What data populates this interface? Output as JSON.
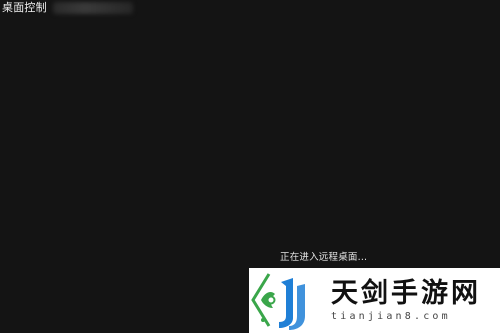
{
  "window": {
    "title": "桌面控制"
  },
  "main": {
    "status_text": "正在进入远程桌面..."
  },
  "watermark": {
    "name_cn": "天剑手游网",
    "domain": "tianjian8.com"
  },
  "colors": {
    "background": "#141414",
    "text": "#e6e6e6",
    "watermark_bg": "#ffffff",
    "logo_green": "#3aa64a",
    "logo_blue": "#1f7fd6"
  }
}
